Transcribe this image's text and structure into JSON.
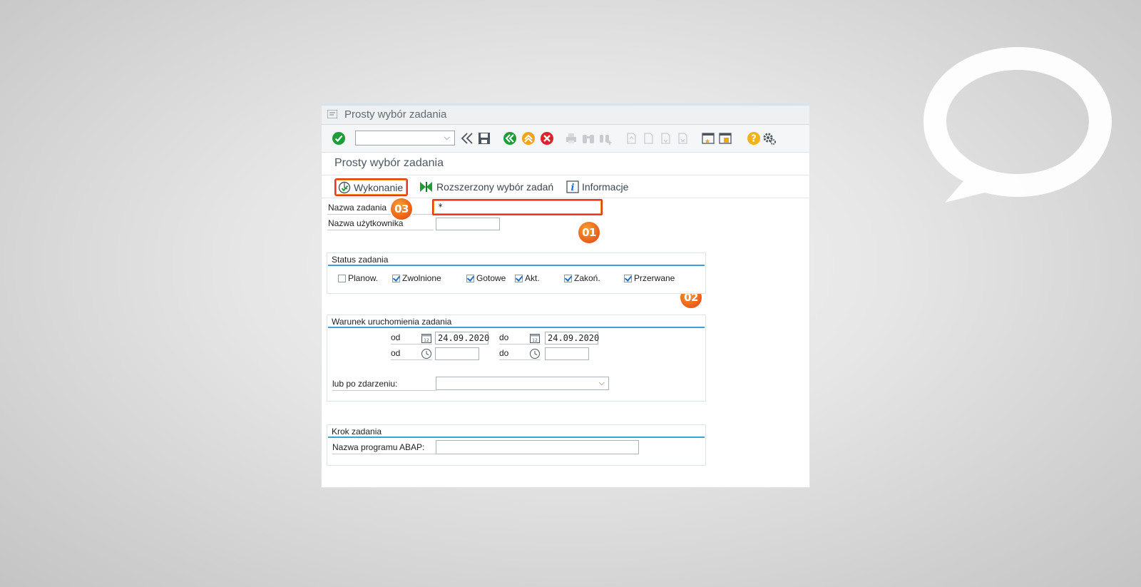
{
  "window": {
    "title": "Prosty wybór zadania"
  },
  "screen": {
    "title": "Prosty wybór zadania"
  },
  "app_toolbar": {
    "execute_label": "Wykonanie",
    "extended_label": "Rozszerzony wybór zadań",
    "info_label": "Informacje"
  },
  "form": {
    "job_name_label": "Nazwa zadania",
    "job_name_value": "*",
    "user_name_label": "Nazwa użytkownika",
    "user_name_value": ""
  },
  "status_group": {
    "title": "Status zadania",
    "items": [
      {
        "label": "Planow.",
        "checked": false
      },
      {
        "label": "Zwolnione",
        "checked": true
      },
      {
        "label": "Gotowe",
        "checked": true
      },
      {
        "label": "Akt.",
        "checked": true
      },
      {
        "label": "Zakoń.",
        "checked": true
      },
      {
        "label": "Przerwane",
        "checked": true
      }
    ]
  },
  "start_group": {
    "title": "Warunek uruchomienia zadania",
    "from_label": "od",
    "to_label": "do",
    "date_from": "24.09.2020",
    "date_to": "24.09.2020",
    "time_from_label": "od",
    "time_to_label": "do",
    "event_label": "lub po zdarzeniu:"
  },
  "step_group": {
    "title": "Krok zadania",
    "program_label": "Nazwa programu ABAP:",
    "program_value": ""
  },
  "badges": {
    "b1": "01",
    "b2": "02",
    "b3": "03"
  },
  "colors": {
    "highlight_red": "#e53a1d",
    "highlight_orange": "#f29320",
    "group_line_blue": "#3aa0d8",
    "ok_green": "#1f9d3a"
  }
}
